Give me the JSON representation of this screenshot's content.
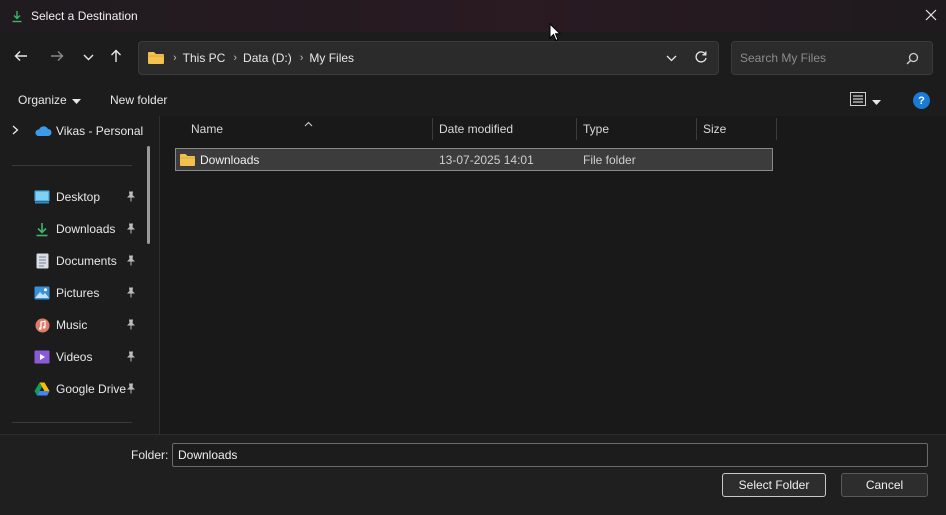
{
  "window": {
    "title": "Select a Destination"
  },
  "nav": {
    "breadcrumbs": [
      "This PC",
      "Data (D:)",
      "My Files"
    ]
  },
  "search": {
    "placeholder": "Search My Files"
  },
  "toolbar": {
    "organize_label": "Organize",
    "new_folder_label": "New folder",
    "help_label": "?"
  },
  "sidebar": {
    "top_item": "Vikas - Personal",
    "items": [
      {
        "label": "Desktop",
        "icon": "desktop-icon"
      },
      {
        "label": "Downloads",
        "icon": "download-icon"
      },
      {
        "label": "Documents",
        "icon": "documents-icon"
      },
      {
        "label": "Pictures",
        "icon": "pictures-icon"
      },
      {
        "label": "Music",
        "icon": "music-icon"
      },
      {
        "label": "Videos",
        "icon": "videos-icon"
      },
      {
        "label": "Google Drive",
        "icon": "google-drive-icon"
      }
    ]
  },
  "columns": {
    "name": "Name",
    "date": "Date modified",
    "type": "Type",
    "size": "Size"
  },
  "files": [
    {
      "name": "Downloads",
      "date": "13-07-2025 14:01",
      "type": "File folder",
      "size": ""
    }
  ],
  "footer": {
    "folder_label": "Folder:",
    "folder_value": "Downloads",
    "select_label": "Select Folder",
    "cancel_label": "Cancel"
  },
  "colors": {
    "accent": "#1a7ad4",
    "folder": "#f2c14e",
    "selection": "#3c3c3c"
  }
}
